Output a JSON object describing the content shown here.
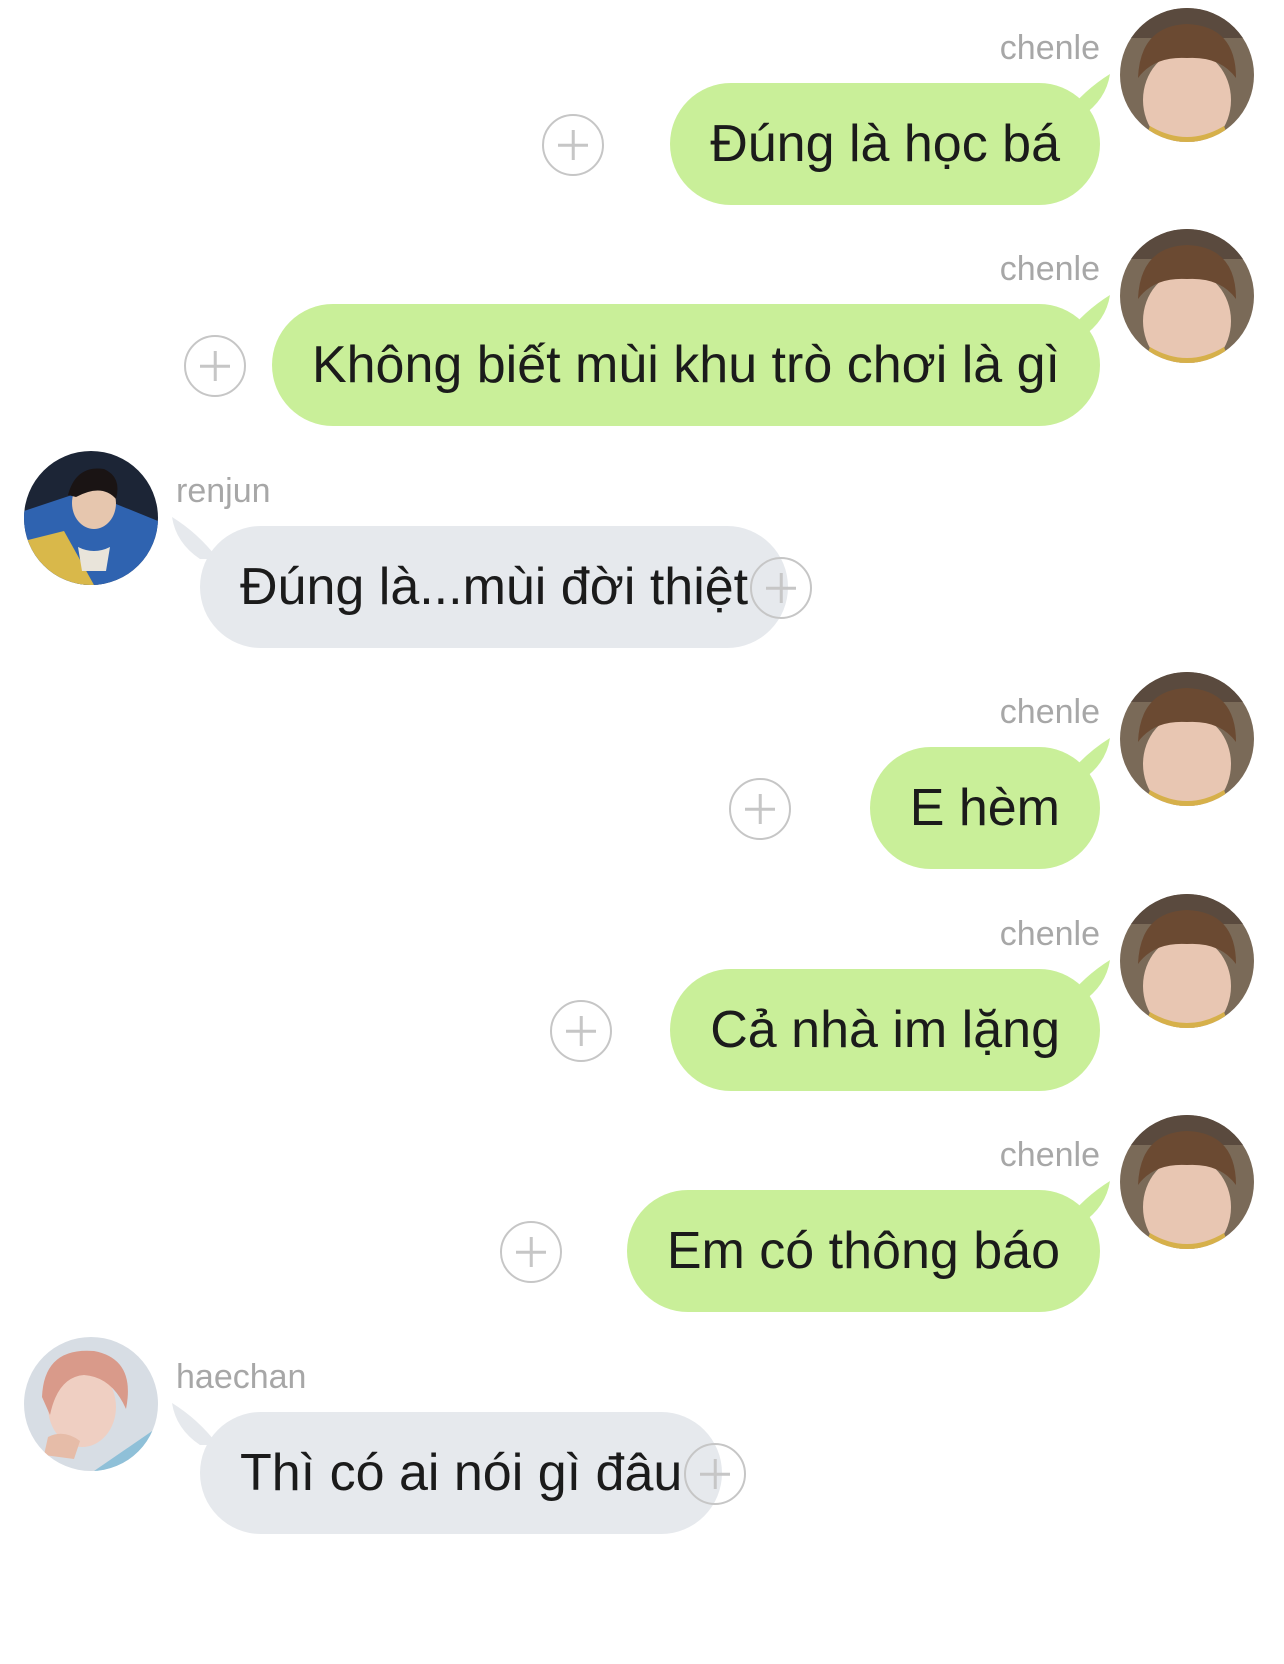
{
  "messages": [
    {
      "sender": "chenle",
      "text": "Đúng là học bá",
      "direction": "outgoing"
    },
    {
      "sender": "chenle",
      "text": "Không biết mùi khu trò chơi là gì",
      "direction": "outgoing"
    },
    {
      "sender": "renjun",
      "text": "Đúng là...mùi đời thiệt",
      "direction": "incoming"
    },
    {
      "sender": "chenle",
      "text": "E hèm",
      "direction": "outgoing"
    },
    {
      "sender": "chenle",
      "text": "Cả nhà im lặng",
      "direction": "outgoing"
    },
    {
      "sender": "chenle",
      "text": "Em có thông báo",
      "direction": "outgoing"
    },
    {
      "sender": "haechan",
      "text": "Thì có ai nói gì đâu",
      "direction": "incoming"
    }
  ],
  "colors": {
    "outgoing_bubble": "#c9ef99",
    "incoming_bubble": "#e6e9ed",
    "sender_name": "#a7a7a7",
    "add_icon": "#c6c6c6"
  },
  "icons": {
    "add": "plus-circle-icon"
  }
}
